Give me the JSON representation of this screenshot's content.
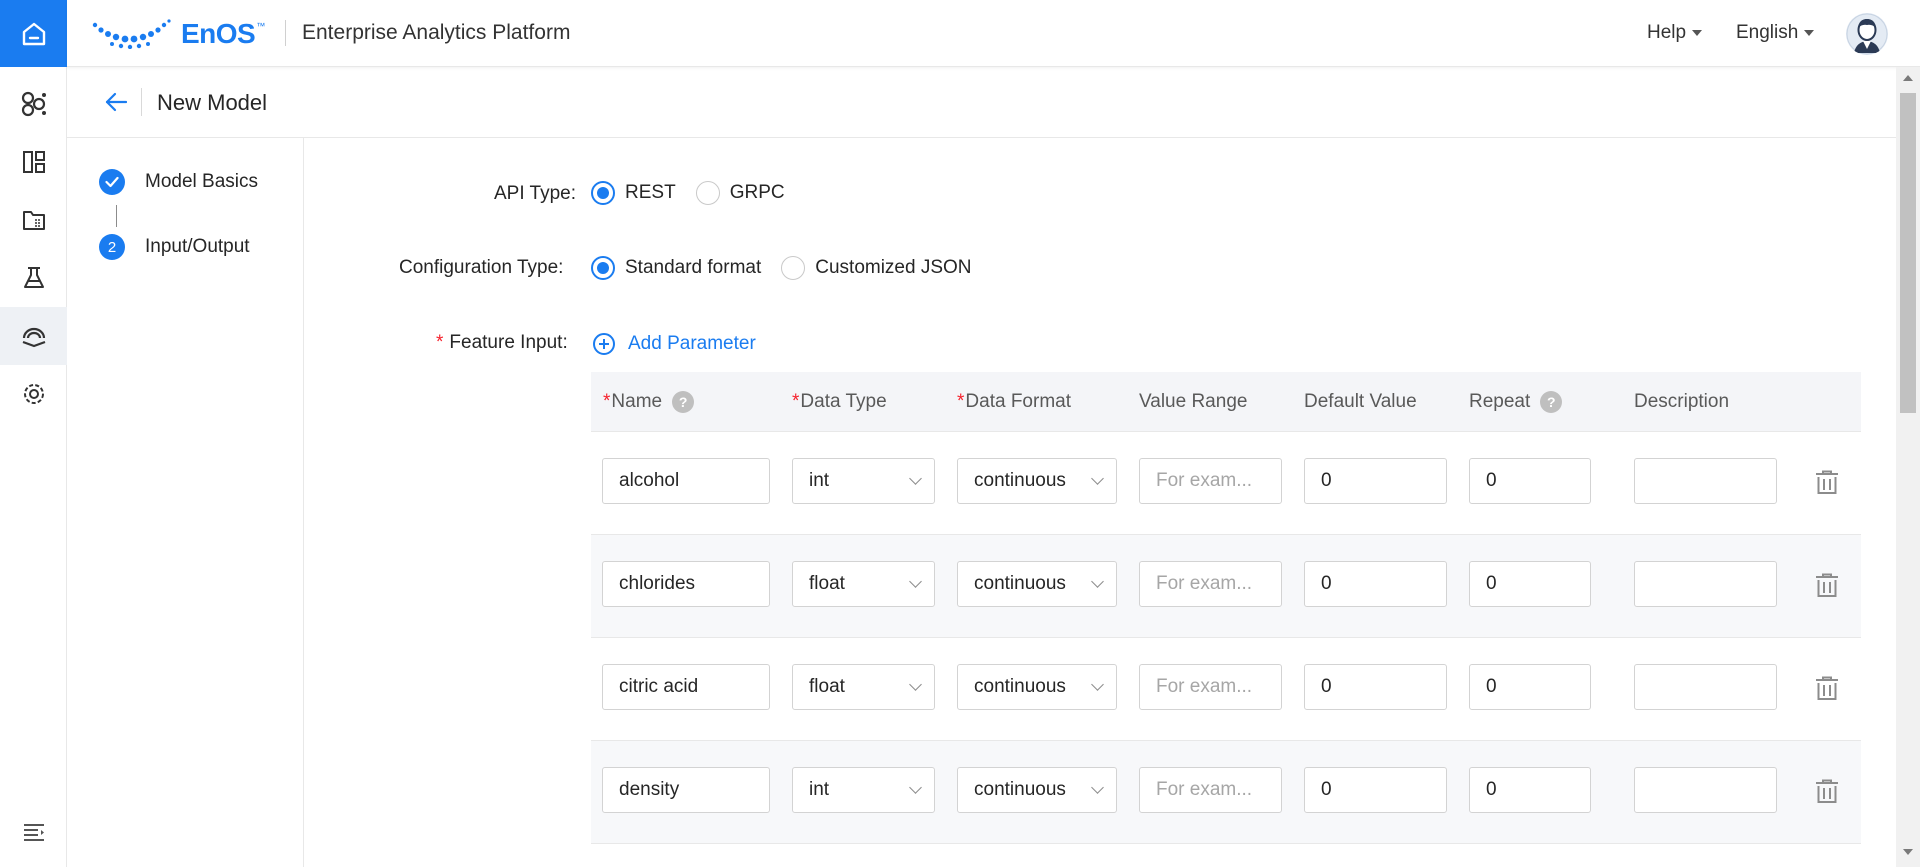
{
  "header": {
    "logo_text": "EnOS",
    "logo_tm": "™",
    "app_title": "Enterprise Analytics Platform",
    "help_label": "Help",
    "language_label": "English"
  },
  "rail": {
    "icons": [
      "home-icon",
      "model-hub-icon",
      "dashboard-icon",
      "data-folder-icon",
      "flask-icon",
      "model-deploy-icon",
      "settings-icon",
      "collapse-menu-icon"
    ],
    "active_index": 4
  },
  "page": {
    "title": "New Model"
  },
  "steps": [
    {
      "label": "Model Basics",
      "status": "done",
      "number": ""
    },
    {
      "label": "Input/Output",
      "status": "current",
      "number": "2"
    }
  ],
  "form": {
    "api_type": {
      "label": "API Type",
      "colon": ":",
      "options": [
        "REST",
        "GRPC"
      ],
      "selected": "REST"
    },
    "config_type": {
      "label": "Configuration Type",
      "colon": ":",
      "options": [
        "Standard format",
        "Customized JSON"
      ],
      "selected": "Standard format"
    },
    "feature_input": {
      "required_mark": "*",
      "label": "Feature Input",
      "colon": ":",
      "add_label": "Add Parameter"
    }
  },
  "table": {
    "columns": [
      {
        "key": "name",
        "label": "Name",
        "required": true,
        "help": true
      },
      {
        "key": "data_type",
        "label": "Data Type",
        "required": true,
        "help": false
      },
      {
        "key": "data_format",
        "label": "Data Format",
        "required": true,
        "help": false
      },
      {
        "key": "value_range",
        "label": "Value Range",
        "required": false,
        "help": false
      },
      {
        "key": "default_value",
        "label": "Default Value",
        "required": false,
        "help": false
      },
      {
        "key": "repeat",
        "label": "Repeat",
        "required": false,
        "help": true
      },
      {
        "key": "description",
        "label": "Description",
        "required": false,
        "help": false
      }
    ],
    "required_mark": "*",
    "help_glyph": "?",
    "value_range_placeholder": "For exam...",
    "rows": [
      {
        "name": "alcohol",
        "data_type": "int",
        "data_format": "continuous",
        "default_value": "0",
        "repeat": "0",
        "description": ""
      },
      {
        "name": "chlorides",
        "data_type": "float",
        "data_format": "continuous",
        "default_value": "0",
        "repeat": "0",
        "description": ""
      },
      {
        "name": "citric acid",
        "data_type": "float",
        "data_format": "continuous",
        "default_value": "0",
        "repeat": "0",
        "description": ""
      },
      {
        "name": "density",
        "data_type": "int",
        "data_format": "continuous",
        "default_value": "0",
        "repeat": "0",
        "description": ""
      }
    ]
  },
  "colors": {
    "accent": "#1a7cf0",
    "required": "#f5222d",
    "header_bg": "#f4f5f8"
  }
}
